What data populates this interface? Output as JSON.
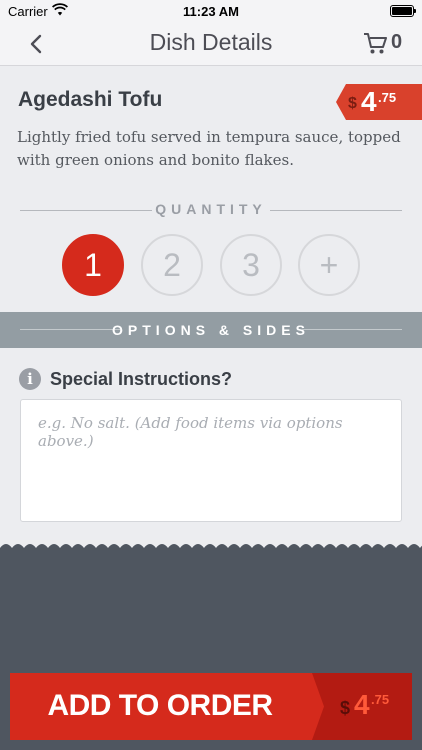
{
  "status_bar": {
    "carrier": "Carrier",
    "time": "11:23 AM"
  },
  "nav": {
    "title": "Dish Details",
    "cart_count": "0"
  },
  "dish": {
    "name": "Agedashi Tofu",
    "price_currency": "$",
    "price_dollars": "4",
    "price_cents": ".75",
    "description": "Lightly fried tofu served in tempura sauce, topped with green onions and bonito flakes."
  },
  "quantity": {
    "label": "QUANTITY",
    "options": [
      "1",
      "2",
      "3",
      "+"
    ],
    "selected": "1"
  },
  "options_sides": {
    "label": "OPTIONS & SIDES"
  },
  "instructions": {
    "title": "Special Instructions?",
    "placeholder": "e.g. No salt. (Add food items via options above.)"
  },
  "add_to_order": {
    "label": "ADD TO ORDER",
    "price_currency": "$",
    "price_dollars": "4",
    "price_cents": ".75"
  },
  "colors": {
    "accent_red": "#d52a1c",
    "price_tag": "#d9412c",
    "band_gray": "#939da3",
    "bottom_dark": "#4f5660"
  }
}
